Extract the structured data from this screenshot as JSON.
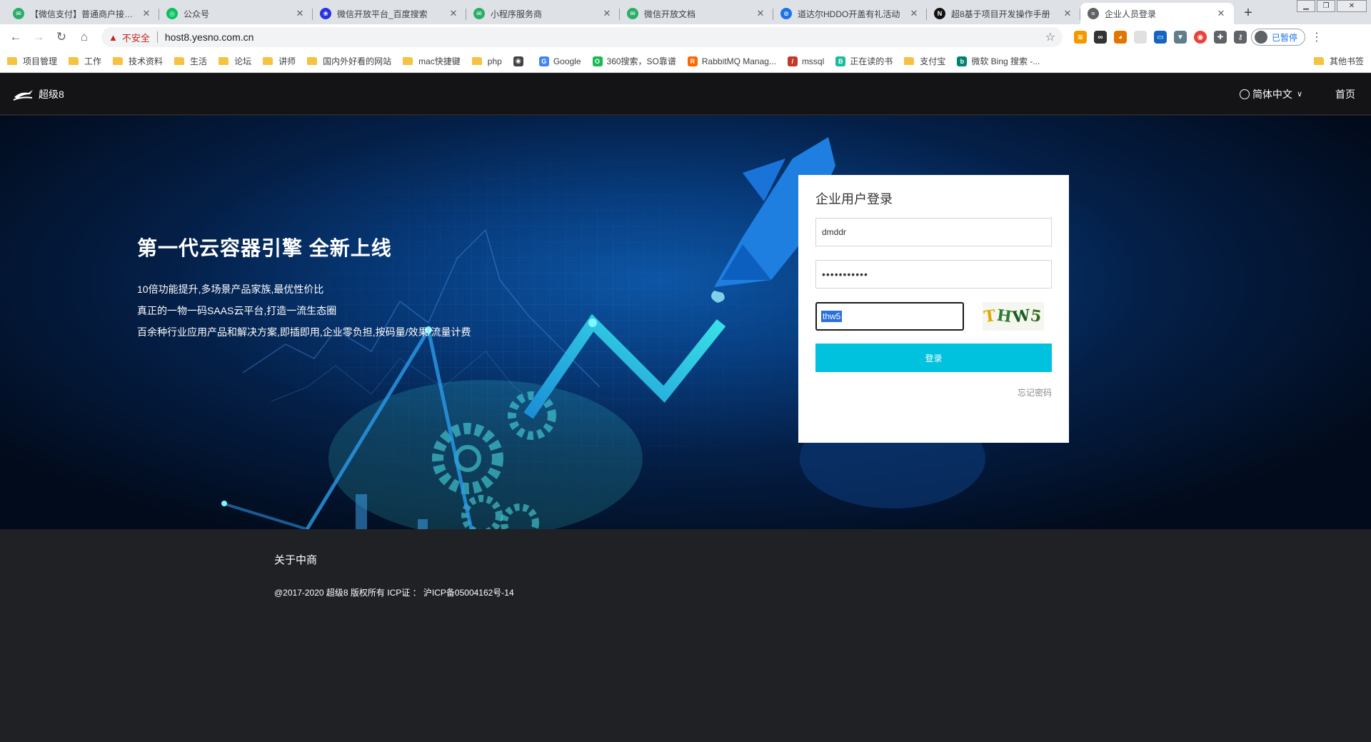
{
  "browser": {
    "tabs": [
      {
        "title": "【微信支付】普通商户接入文",
        "fav_color": "#2aae67",
        "fav_glyph": "✉"
      },
      {
        "title": "公众号",
        "fav_color": "#07c160",
        "fav_glyph": "◎"
      },
      {
        "title": "微信开放平台_百度搜索",
        "fav_color": "#2932e1",
        "fav_glyph": "❀"
      },
      {
        "title": "小程序服务商",
        "fav_color": "#2aae67",
        "fav_glyph": "✉"
      },
      {
        "title": "微信开放文档",
        "fav_color": "#2aae67",
        "fav_glyph": "✉"
      },
      {
        "title": "道达尔HDDO开盖有礼活动",
        "fav_color": "#1a73e8",
        "fav_glyph": "⊙"
      },
      {
        "title": "超8基于项目开发操作手册",
        "fav_color": "#111111",
        "fav_glyph": "N"
      },
      {
        "title": "企业人员登录",
        "fav_color": "#5f6368",
        "fav_glyph": "≈"
      }
    ],
    "new_tab_glyph": "+",
    "url": "host8.yesno.com.cn",
    "insecure_label": "不安全",
    "profile_label": "已暂停",
    "bookmarks": [
      {
        "label": "项目管理",
        "type": "folder"
      },
      {
        "label": "工作",
        "type": "folder"
      },
      {
        "label": "技术资料",
        "type": "folder"
      },
      {
        "label": "生活",
        "type": "folder"
      },
      {
        "label": "论坛",
        "type": "folder"
      },
      {
        "label": "讲师",
        "type": "folder"
      },
      {
        "label": "国内外好看的网站",
        "type": "folder"
      },
      {
        "label": "mac快捷键",
        "type": "folder"
      },
      {
        "label": "php",
        "type": "folder"
      },
      {
        "label": "",
        "type": "site",
        "color": "#444444",
        "glyph": "◉"
      },
      {
        "label": "Google",
        "type": "site",
        "color": "#4285f4",
        "glyph": "G"
      },
      {
        "label": "360搜索，SO靠谱",
        "type": "site",
        "color": "#19b955",
        "glyph": "O"
      },
      {
        "label": "RabbitMQ Manag...",
        "type": "site",
        "color": "#f60",
        "glyph": "R"
      },
      {
        "label": "mssql",
        "type": "site",
        "color": "#c0392b",
        "glyph": "/"
      },
      {
        "label": "正在读的书",
        "type": "site",
        "color": "#1abc9c",
        "glyph": "B"
      },
      {
        "label": "支付宝",
        "type": "folder"
      },
      {
        "label": "微软 Bing 搜索 -...",
        "type": "site",
        "color": "#008373",
        "glyph": "b"
      }
    ],
    "other_bookmarks": "其他书签"
  },
  "site": {
    "logo_text": "超级8",
    "language": "简体中文",
    "home": "首页"
  },
  "hero": {
    "title": "第一代云容器引擎 全新上线",
    "lines": [
      "10倍功能提升,多场景产品家族,最优性价比",
      "真正的一物一码SAAS云平台,打造一流生态圈",
      "百余种行业应用产品和解决方案,即插即用,企业零负担,按码量/效果/流量计费"
    ]
  },
  "login": {
    "title": "企业用户登录",
    "username_value": "dmddr",
    "password_value": "•••••••••••",
    "captcha_value": "thw5",
    "captcha_image_text": "THW5",
    "submit_label": "登录",
    "forgot_label": "忘记密码"
  },
  "footer": {
    "about": "关于中商",
    "copyright": "@2017-2020 超级8 版权所有 ICP证 ： 沪ICP备05004162号-14"
  },
  "colors": {
    "accent": "#00c2de",
    "header_bg": "#141416",
    "footer_bg": "#202124"
  }
}
